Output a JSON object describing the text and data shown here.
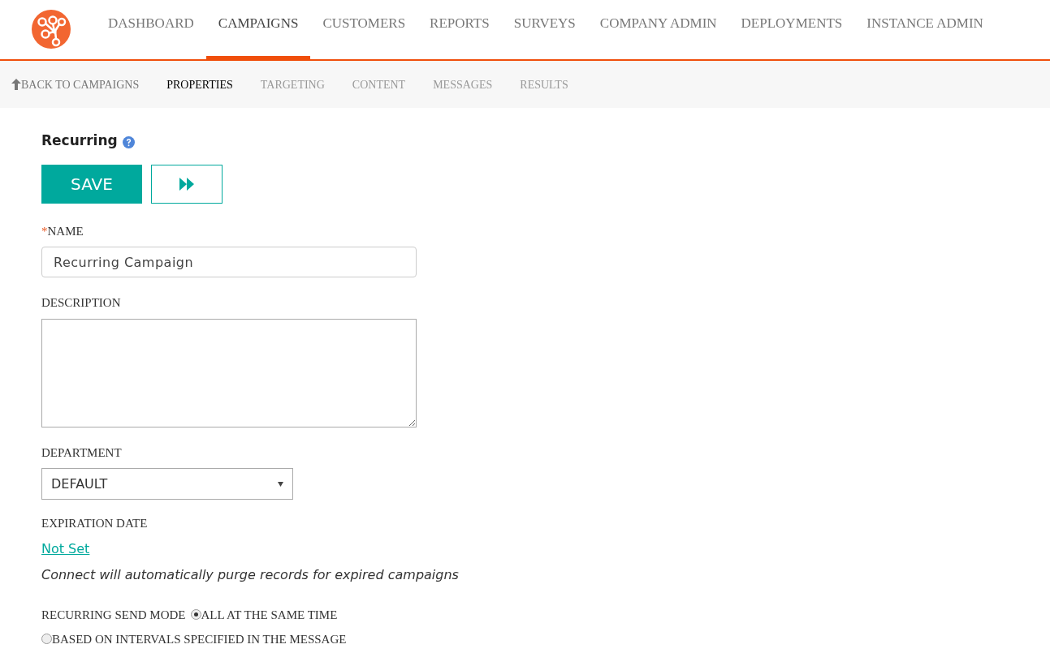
{
  "nav": {
    "items": [
      {
        "label": "DASHBOARD",
        "selected": false
      },
      {
        "label": "CAMPAIGNS",
        "selected": true
      },
      {
        "label": "CUSTOMERS",
        "selected": false
      },
      {
        "label": "REPORTS",
        "selected": false
      },
      {
        "label": "SURVEYS",
        "selected": false
      },
      {
        "label": "COMPANY ADMIN",
        "selected": false
      },
      {
        "label": "DEPLOYMENTS",
        "selected": false
      },
      {
        "label": "INSTANCE ADMIN",
        "selected": false
      }
    ]
  },
  "subnav": {
    "back": "BACK TO CAMPAIGNS",
    "tabs": [
      {
        "label": "PROPERTIES",
        "selected": true
      },
      {
        "label": "TARGETING",
        "selected": false
      },
      {
        "label": "CONTENT",
        "selected": false
      },
      {
        "label": "MESSAGES",
        "selected": false
      },
      {
        "label": "RESULTS",
        "selected": false
      }
    ]
  },
  "title": "Recurring",
  "save_button": "SAVE",
  "form": {
    "name": {
      "required_mark": "*",
      "label": "NAME",
      "value": "Recurring Campaign"
    },
    "description": {
      "label": "DESCRIPTION"
    },
    "department": {
      "label": "DEPARTMENT",
      "value": "DEFAULT"
    },
    "expiration": {
      "label": "EXPIRATION DATE",
      "link": "Not Set",
      "note": "Connect will automatically purge records for expired campaigns"
    },
    "send_mode": {
      "label": "RECURRING SEND MODE",
      "options": [
        {
          "label": "ALL AT THE SAME TIME",
          "selected": true
        },
        {
          "label": "BASED ON INTERVALS SPECIFIED IN THE MESSAGE",
          "selected": false
        }
      ]
    }
  }
}
